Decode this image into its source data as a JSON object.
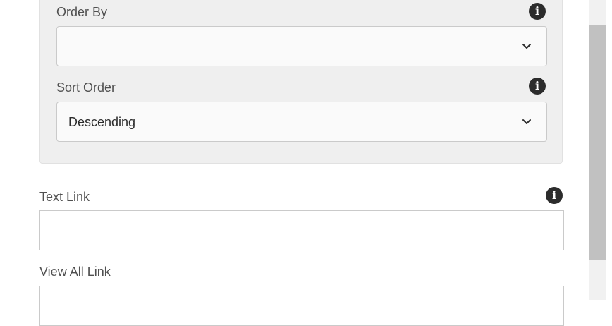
{
  "filter_panel": {
    "order_by": {
      "label": "Order By",
      "value": ""
    },
    "sort_order": {
      "label": "Sort Order",
      "value": "Descending"
    }
  },
  "fields": {
    "text_link": {
      "label": "Text Link",
      "value": ""
    },
    "view_all_link": {
      "label": "View All Link",
      "value": ""
    }
  },
  "icons": {
    "info": "info-icon",
    "chevron": "chevron-down-icon"
  }
}
